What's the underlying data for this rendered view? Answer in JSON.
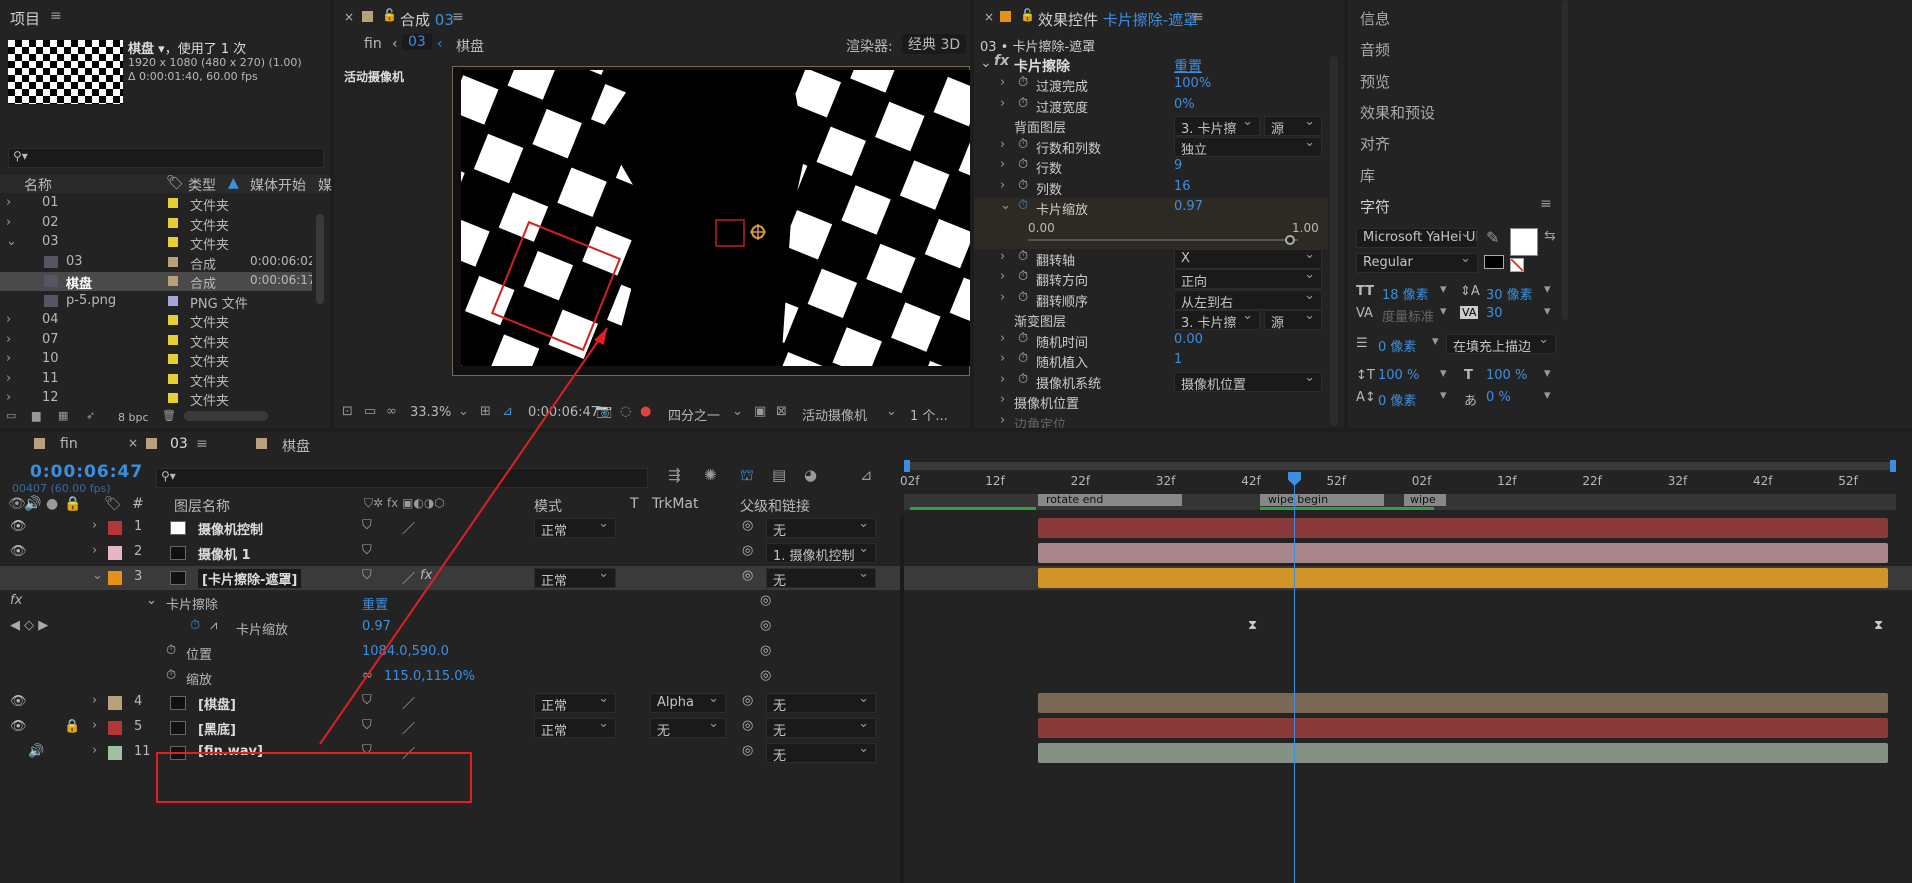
{
  "project": {
    "title": "项目",
    "item_name": "棋盘",
    "item_used": "，使用了 1 次",
    "item_res": "1920 x 1080 (480 x 270) (1.00)",
    "item_dur": "Δ 0:00:01:40, 60.00 fps",
    "col_name": "名称",
    "col_type": "类型",
    "col_start": "媒体开始",
    "col_extra": "媒",
    "rows": [
      {
        "name": "01",
        "type": "文件夹",
        "start": "",
        "color": "#e6cf34",
        "indent": 0,
        "arrow": "›"
      },
      {
        "name": "02",
        "type": "文件夹",
        "start": "",
        "color": "#e6cf34",
        "indent": 0,
        "arrow": "›"
      },
      {
        "name": "03",
        "type": "文件夹",
        "start": "",
        "color": "#e6cf34",
        "indent": 0,
        "arrow": "⌄"
      },
      {
        "name": "03",
        "type": "合成",
        "start": "0:00:06:02",
        "color": "#b8a07a",
        "indent": 1,
        "arrow": ""
      },
      {
        "name": "棋盘",
        "type": "合成",
        "start": "0:00:06:17",
        "color": "#b8a07a",
        "indent": 1,
        "arrow": ""
      },
      {
        "name": "p-5.png",
        "type": "PNG 文件",
        "start": "",
        "color": "#a5a5d8",
        "indent": 1,
        "arrow": ""
      },
      {
        "name": "04",
        "type": "文件夹",
        "start": "",
        "color": "#e6cf34",
        "indent": 0,
        "arrow": "›"
      },
      {
        "name": "07",
        "type": "文件夹",
        "start": "",
        "color": "#e6cf34",
        "indent": 0,
        "arrow": "›"
      },
      {
        "name": "10",
        "type": "文件夹",
        "start": "",
        "color": "#e6cf34",
        "indent": 0,
        "arrow": "›"
      },
      {
        "name": "11",
        "type": "文件夹",
        "start": "",
        "color": "#e6cf34",
        "indent": 0,
        "arrow": "›"
      },
      {
        "name": "12",
        "type": "文件夹",
        "start": "",
        "color": "#e6cf34",
        "indent": 0,
        "arrow": "›"
      }
    ],
    "bpc": "8 bpc"
  },
  "comp": {
    "title": "合成",
    "title_name": "03",
    "crumb1": "fin",
    "crumb2": "03",
    "crumb3": "棋盘",
    "renderer_label": "渲染器:",
    "renderer": "经典 3D",
    "view_label": "活动摄像机",
    "zoom": "33.3%",
    "time": "0:00:06:47",
    "res": "四分之一",
    "camera": "活动摄像机",
    "views": "1 个..."
  },
  "effects": {
    "title": "效果控件",
    "layer": "卡片擦除-遮罩",
    "breadcrumb": "03 • 卡片擦除-遮罩",
    "effect": "卡片擦除",
    "reset": "重置",
    "props": [
      {
        "label": "过渡完成",
        "value": "100%",
        "type": "num",
        "stop": true
      },
      {
        "label": "过渡宽度",
        "value": "0%",
        "type": "num",
        "stop": true
      },
      {
        "label": "背面图层",
        "value": "3. 卡片擦",
        "value2": "源",
        "type": "dd2",
        "stop": false
      },
      {
        "label": "行数和列数",
        "value": "独立",
        "type": "dd",
        "stop": true
      },
      {
        "label": "行数",
        "value": "9",
        "type": "num",
        "stop": true
      },
      {
        "label": "列数",
        "value": "16",
        "type": "num",
        "stop": true
      },
      {
        "label": "卡片缩放",
        "value": "0.97",
        "type": "num",
        "stop": true,
        "open": true
      },
      {
        "label": "翻转轴",
        "value": "X",
        "type": "dd",
        "stop": true
      },
      {
        "label": "翻转方向",
        "value": "正向",
        "type": "dd",
        "stop": true
      },
      {
        "label": "翻转顺序",
        "value": "从左到右",
        "type": "dd",
        "stop": true
      },
      {
        "label": "渐变图层",
        "value": "3. 卡片擦",
        "value2": "源",
        "type": "dd2",
        "stop": false
      },
      {
        "label": "随机时间",
        "value": "0.00",
        "type": "num",
        "stop": true
      },
      {
        "label": "随机植入",
        "value": "1",
        "type": "num",
        "stop": true
      },
      {
        "label": "摄像机系统",
        "value": "摄像机位置",
        "type": "dd",
        "stop": true
      },
      {
        "label": "摄像机位置",
        "value": "",
        "type": "group",
        "stop": false
      },
      {
        "label": "边角定位",
        "value": "",
        "type": "group",
        "stop": false
      }
    ],
    "slider_min": "0.00",
    "slider_max": "1.00",
    "slider_value": 0.97
  },
  "right": {
    "items": [
      "信息",
      "音频",
      "预览",
      "效果和预设",
      "对齐",
      "库"
    ],
    "char_title": "字符",
    "font": "Microsoft YaHei UI",
    "style": "Regular",
    "size": "18 像素",
    "leading": "30 像素",
    "kerning": "度量标准",
    "tracking": "30",
    "stroke": "0 像素",
    "stroke_mode": "在填充上描边",
    "vscale": "100 %",
    "hscale": "100 %",
    "baseline": "0 像素",
    "tsume": "0 %"
  },
  "timeline": {
    "tab1": "fin",
    "tab2": "03",
    "tab3": "棋盘",
    "timecode": "0:00:06:47",
    "frames": "00407 (60.00 fps)",
    "col_name": "图层名称",
    "col_mode": "模式",
    "col_t": "T",
    "col_trk": "TrkMat",
    "col_parent": "父级和链接",
    "ruler": [
      "02f",
      "12f",
      "22f",
      "32f",
      "42f",
      "52f",
      "02f",
      "12f",
      "22f",
      "32f",
      "42f",
      "52f"
    ],
    "markers": [
      "rotate end",
      "wipe begin",
      "wipe"
    ],
    "layers": [
      {
        "num": "1",
        "name": "摄像机控制",
        "color": "#b33535",
        "mode": "正常",
        "trk": "",
        "parent": "无",
        "bar": "#8b3a3a"
      },
      {
        "num": "2",
        "name": "摄像机 1",
        "color": "#e7b6c6",
        "mode": "",
        "trk": "",
        "parent": "1. 摄像机控制",
        "bar": "#a8868c"
      },
      {
        "num": "3",
        "name": "[卡片擦除-遮罩]",
        "color": "#e5901a",
        "mode": "正常",
        "trk": "",
        "parent": "无",
        "bar": "#d19426"
      },
      {
        "num": "4",
        "name": "[棋盘]",
        "color": "#b8a07a",
        "mode": "正常",
        "trk": "Alpha",
        "parent": "无",
        "bar": "#7a6a55"
      },
      {
        "num": "5",
        "name": "[黑底]",
        "color": "#b33535",
        "mode": "正常",
        "trk": "无",
        "parent": "无",
        "bar": "#8b3a3a"
      },
      {
        "num": "11",
        "name": "[fin.wav]",
        "color": "#9fbf9f",
        "mode": "",
        "trk": "",
        "parent": "无",
        "bar": "#849184"
      }
    ],
    "fx_group": "卡片擦除",
    "fx_reset": "重置",
    "fx_prop": "卡片缩放",
    "fx_prop_val": "0.97",
    "pos_label": "位置",
    "pos_val": "1084.0,590.0",
    "scale_label": "缩放",
    "scale_val": "115.0,115.0%"
  }
}
